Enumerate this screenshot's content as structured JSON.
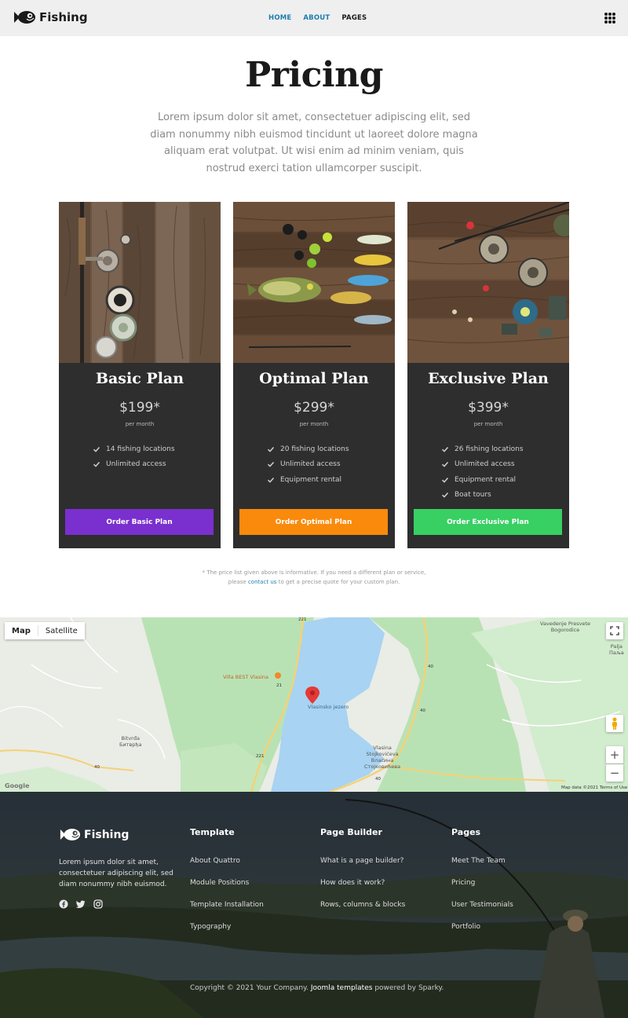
{
  "header": {
    "brand": "Fishing",
    "nav": [
      {
        "label": "HOME"
      },
      {
        "label": "ABOUT"
      },
      {
        "label": "PAGES"
      }
    ]
  },
  "hero": {
    "title": "Pricing",
    "intro": "Lorem ipsum dolor sit amet, consectetuer adipiscing elit, sed diam nonummy nibh euismod tincidunt ut laoreet dolore magna aliquam erat volutpat. Ut wisi enim ad minim veniam, quis nostrud exerci tation ullamcorper suscipit."
  },
  "plans": [
    {
      "name": "Basic Plan",
      "price": "$199*",
      "period": "per month",
      "features": [
        "14 fishing locations",
        "Unlimited access"
      ],
      "button": "Order Basic Plan",
      "button_color": "#7a2fcf"
    },
    {
      "name": "Optimal Plan",
      "price": "$299*",
      "period": "per month",
      "features": [
        "20 fishing locations",
        "Unlimited access",
        "Equipment rental"
      ],
      "button": "Order Optimal Plan",
      "button_color": "#f98a0c"
    },
    {
      "name": "Exclusive Plan",
      "price": "$399*",
      "period": "per month",
      "features": [
        "26 fishing locations",
        "Unlimited access",
        "Equipment rental",
        "Boat tours"
      ],
      "button": "Order Exclusive Plan",
      "button_color": "#38cf63"
    }
  ],
  "note": {
    "line1": "* The price list given above is informative. If you need a different plan or service,",
    "line2_pre": "please",
    "line2_link": "contact us",
    "line2_post": "to get a precise quote for your custom plan."
  },
  "map": {
    "types": [
      "Map",
      "Satellite"
    ],
    "labels": {
      "church": "Vavedenje Presvete\nBogorodice",
      "palja": "Palja\nПаља",
      "villa": "Villa BEST Vlasina",
      "bitvrdja": "Bitvrđa\nБитврђа",
      "vlasina": "Vlasina\nStojkovićeva\nВласина\nСтојковићева",
      "lake": "Vlasinsko jezero",
      "road_221a": "221",
      "road_221b": "221",
      "road_40a": "40",
      "road_40b": "40",
      "road_40c": "40",
      "road_40d": "40",
      "road_21": "21"
    },
    "attribution": "Map data ©2021",
    "terms": "Terms of Use",
    "google": "Google",
    "zoom_in": "+",
    "zoom_out": "−"
  },
  "footer": {
    "brand": "Fishing",
    "about": "Lorem ipsum dolor sit amet, consectetuer adipiscing elit, sed diam nonummy nibh euismod.",
    "columns": [
      {
        "title": "Template",
        "links": [
          "About Quattro",
          "Module Positions",
          "Template Installation",
          "Typography"
        ]
      },
      {
        "title": "Page Builder",
        "links": [
          "What is a page builder?",
          "How does it work?",
          "Rows, columns & blocks"
        ]
      },
      {
        "title": "Pages",
        "links": [
          "Meet The Team",
          "Pricing",
          "User Testimonials",
          "Portfolio"
        ]
      }
    ],
    "copyright_pre": "Copyright © 2021 Your Company.",
    "copyright_link": "Joomla templates",
    "copyright_post": "powered by Sparky."
  },
  "colors": {
    "accent": "#1f7eb0",
    "card_bg": "#2e2e2e",
    "header_bg": "#efefef"
  }
}
